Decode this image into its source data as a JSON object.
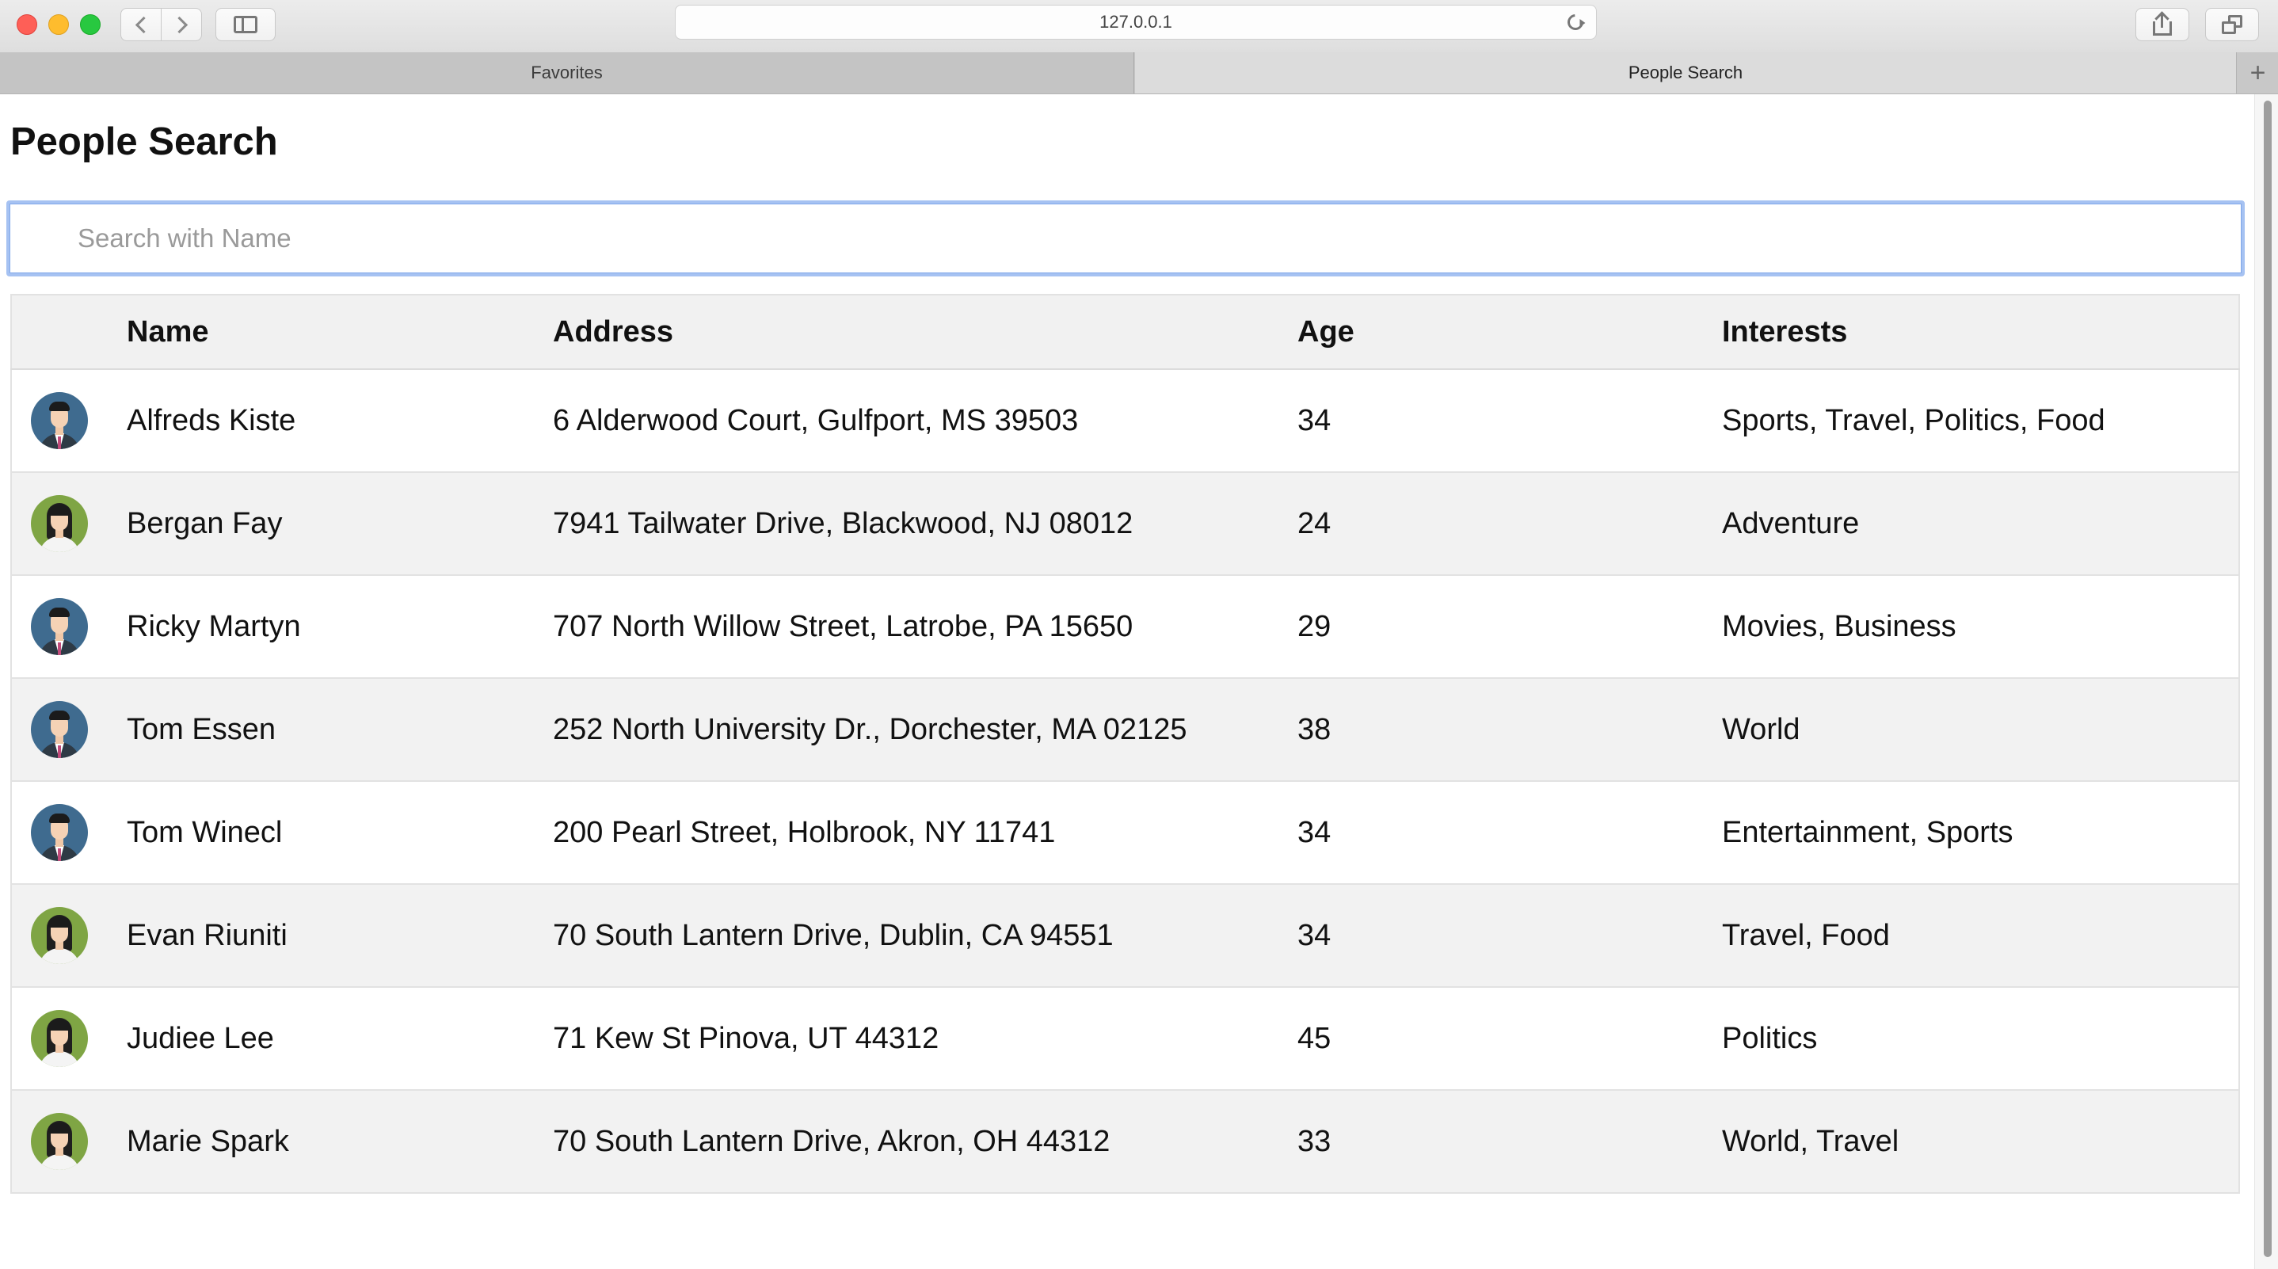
{
  "browser": {
    "url": "127.0.0.1",
    "tabs": [
      {
        "label": "Favorites"
      },
      {
        "label": "People Search"
      }
    ],
    "new_tab_label": "+"
  },
  "page": {
    "title": "People Search",
    "search_placeholder": "Search with Name"
  },
  "table": {
    "headers": {
      "avatar": "",
      "name": "Name",
      "address": "Address",
      "age": "Age",
      "interests": "Interests"
    },
    "rows": [
      {
        "avatar": "male",
        "name": "Alfreds Kiste",
        "address": "6 Alderwood Court, Gulfport, MS 39503",
        "age": "34",
        "interests": "Sports, Travel, Politics, Food"
      },
      {
        "avatar": "female",
        "name": "Bergan Fay",
        "address": "7941 Tailwater Drive, Blackwood, NJ 08012",
        "age": "24",
        "interests": "Adventure"
      },
      {
        "avatar": "male",
        "name": "Ricky Martyn",
        "address": "707 North Willow Street, Latrobe, PA 15650",
        "age": "29",
        "interests": "Movies, Business"
      },
      {
        "avatar": "male",
        "name": "Tom Essen",
        "address": "252 North University Dr., Dorchester, MA 02125",
        "age": "38",
        "interests": "World"
      },
      {
        "avatar": "male",
        "name": "Tom Winecl",
        "address": "200 Pearl Street, Holbrook, NY 11741",
        "age": "34",
        "interests": "Entertainment, Sports"
      },
      {
        "avatar": "female",
        "name": "Evan Riuniti",
        "address": "70 South Lantern Drive, Dublin, CA 94551",
        "age": "34",
        "interests": "Travel, Food"
      },
      {
        "avatar": "female",
        "name": "Judiee Lee",
        "address": "71 Kew St Pinova, UT 44312",
        "age": "45",
        "interests": "Politics"
      },
      {
        "avatar": "female",
        "name": "Marie Spark",
        "address": "70 South Lantern Drive, Akron, OH 44312",
        "age": "33",
        "interests": "World, Travel"
      }
    ]
  },
  "icons": {
    "male_avatar": "male-avatar-icon",
    "female_avatar": "female-avatar-icon"
  },
  "colors": {
    "focus_ring": "#a6c2f2",
    "male_avatar_bg": "#3f6b8f",
    "female_avatar_bg": "#7fa544"
  }
}
